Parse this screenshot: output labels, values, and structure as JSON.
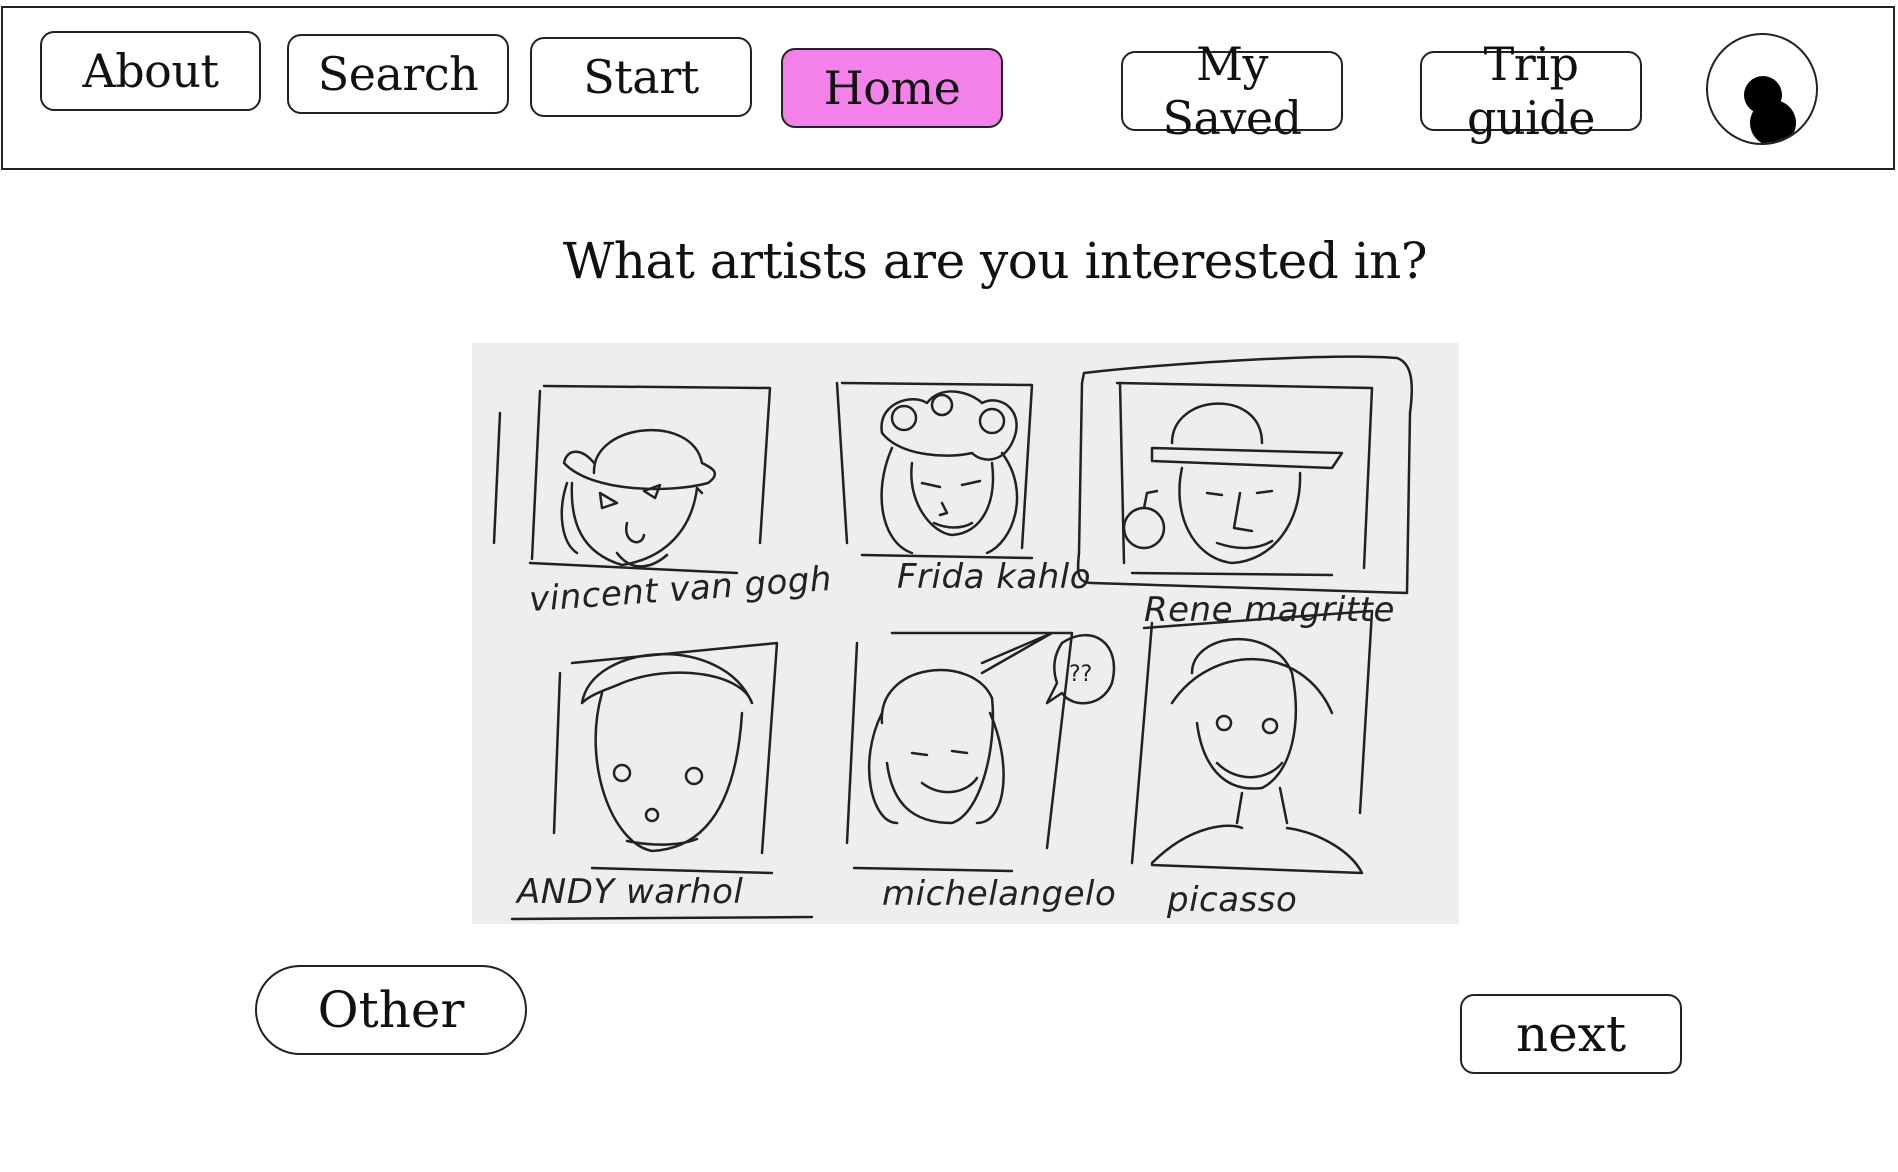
{
  "nav": {
    "about": "About",
    "search": "Search",
    "start": "Start",
    "home": "Home",
    "my_saved": "My Saved",
    "trip_guide": "Trip guide",
    "active_tab": "Home",
    "active_color": "#f282ea",
    "profile_icon": "user-profile-icon"
  },
  "main": {
    "question": "What artists are you interested in?",
    "artists": [
      {
        "name": "vincent van gogh"
      },
      {
        "name": "Frida kahlo"
      },
      {
        "name": "Rene magritte"
      },
      {
        "name": "ANDY warhol"
      },
      {
        "name": "michelangelo"
      },
      {
        "name": "picasso"
      }
    ]
  },
  "actions": {
    "other": "Other",
    "next": "next"
  }
}
